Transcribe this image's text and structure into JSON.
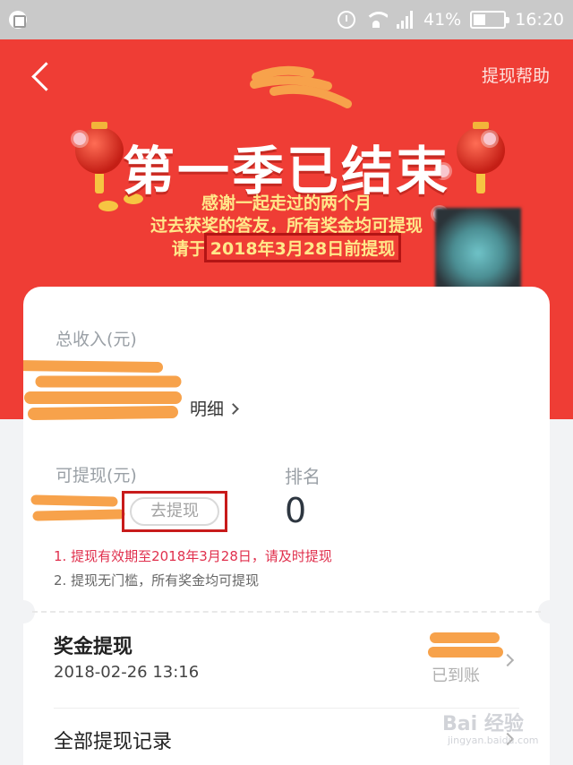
{
  "status_bar": {
    "battery_percent": "41%",
    "battery_level": 0.41,
    "time": "16:20"
  },
  "header": {
    "back_icon": "back-chevron-icon",
    "help_label": "提现帮助"
  },
  "banner": {
    "title": "第一季已结束",
    "line1": "感谢一起走过的两个月",
    "line2": "过去获奖的答友，所有奖金均可提现",
    "line3_prefix": "请于",
    "line3_highlight": "2018年3月28日前提现",
    "background_color": "#ef3d35"
  },
  "earnings": {
    "total_label": "总收入(元)",
    "detail_label": "明细",
    "withdrawable_label": "可提现(元)",
    "withdraw_button": "去提现",
    "rank_label": "排名",
    "rank_value": "0",
    "note1": "1. 提现有效期至2018年3月28日，请及时提现",
    "note2": "2. 提现无门槛，所有奖金均可提现"
  },
  "records": {
    "item_title": "奖金提现",
    "item_time": "2018-02-26 13:16",
    "item_status": "已到账",
    "all_label": "全部提现记录"
  },
  "watermark": {
    "main": "Bai 经验",
    "sub": "jingyan.baidu.com"
  },
  "colors": {
    "accent_red": "#ef3d35",
    "highlight_yellow": "#ffe88a",
    "note_red": "#e0304d",
    "redaction_orange": "#f7a24b"
  }
}
